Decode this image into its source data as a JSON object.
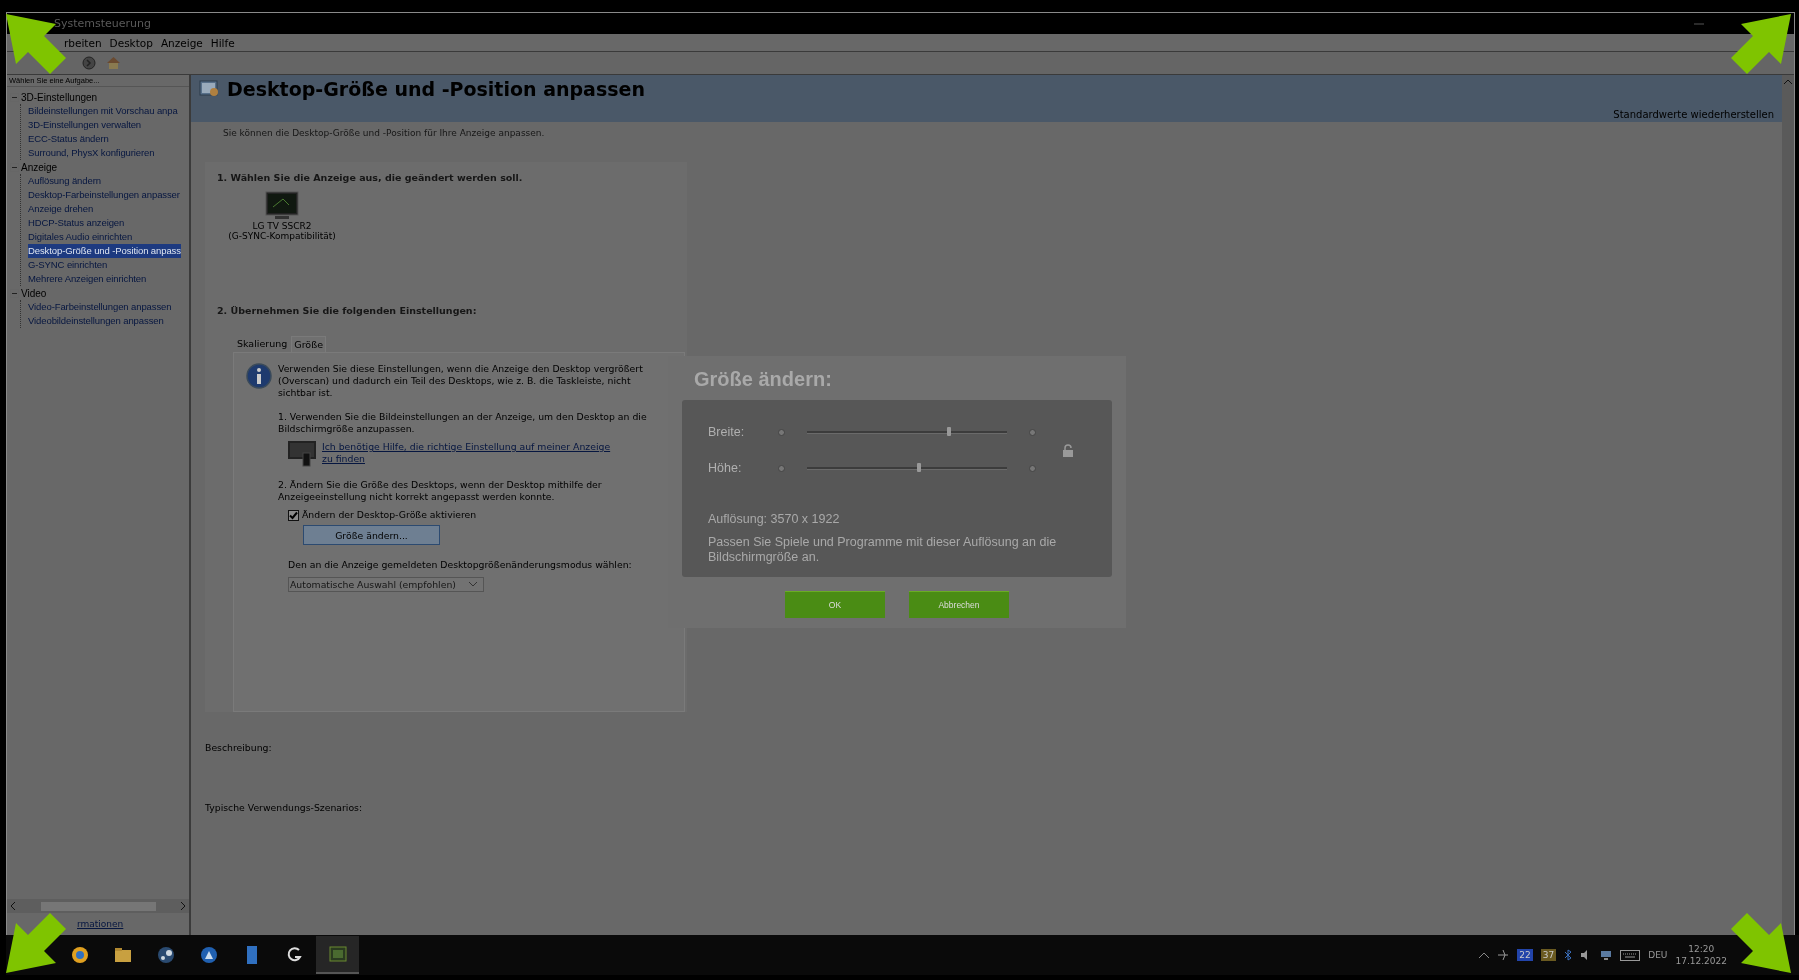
{
  "window": {
    "title": "Systemsteuerung"
  },
  "menu": [
    "rbeiten",
    "Desktop",
    "Anzeige",
    "Hilfe"
  ],
  "toolbar": {
    "hint": "Wählen Sie eine Aufgabe..."
  },
  "sidebar": {
    "tree": [
      {
        "label": "3D-Einstellungen",
        "expanded": true,
        "children": [
          {
            "label": "Bildeinstellungen mit Vorschau anpa",
            "selected": false
          },
          {
            "label": "3D-Einstellungen verwalten",
            "selected": false
          },
          {
            "label": "ECC-Status ändern",
            "selected": false
          },
          {
            "label": "Surround, PhysX konfigurieren",
            "selected": false
          }
        ]
      },
      {
        "label": "Anzeige",
        "expanded": true,
        "children": [
          {
            "label": "Auflösung ändern",
            "selected": false
          },
          {
            "label": "Desktop-Farbeinstellungen anpasser",
            "selected": false
          },
          {
            "label": "Anzeige drehen",
            "selected": false
          },
          {
            "label": "HDCP-Status anzeigen",
            "selected": false
          },
          {
            "label": "Digitales Audio einrichten",
            "selected": false
          },
          {
            "label": "Desktop-Größe und -Position anpass",
            "selected": true
          },
          {
            "label": "G-SYNC einrichten",
            "selected": false
          },
          {
            "label": "Mehrere Anzeigen einrichten",
            "selected": false
          }
        ]
      },
      {
        "label": "Video",
        "expanded": true,
        "children": [
          {
            "label": "Video-Farbeinstellungen anpassen",
            "selected": false
          },
          {
            "label": "Videobildeinstellungen anpassen",
            "selected": false
          }
        ]
      }
    ],
    "footer_link": "rmationen"
  },
  "page": {
    "title": "Desktop-Größe und -Position anpassen",
    "restore_link": "Standardwerte wiederherstellen",
    "intro": "Sie können die Desktop-Größe und -Position für Ihre Anzeige anpassen.",
    "step1": {
      "heading": "1. Wählen Sie die Anzeige aus, die geändert werden soll.",
      "display": {
        "name": "LG TV SSCR2",
        "subtitle": "(G-SYNC-Kompatibilität)"
      }
    },
    "step2": {
      "heading": "2. Übernehmen Sie die folgenden Einstellungen:",
      "tabs": [
        {
          "label": "Skalierung",
          "selected": false
        },
        {
          "label": "Größe",
          "selected": true
        }
      ],
      "info": "Verwenden Sie diese Einstellungen, wenn die Anzeige den Desktop vergrößert (Overscan) und dadurch ein Teil des Desktops, wie z. B. die Taskleiste, nicht sichtbar ist.",
      "item1": "1. Verwenden Sie die Bildeinstellungen an der Anzeige, um den Desktop an die Bildschirmgröße anzupassen.",
      "help_link": "Ich benötige Hilfe, die richtige Einstellung auf meiner Anzeige zu finden",
      "item2": "2. Ändern Sie die Größe des Desktops, wenn der Desktop mithilfe der Anzeigeeinstellung nicht korrekt angepasst werden konnte.",
      "checkbox": {
        "label": "Ändern der Desktop-Größe aktivieren",
        "checked": true
      },
      "resize_button": "Größe ändern...",
      "mode_label": "Den an die Anzeige gemeldeten Desktopgrößenänderungsmodus wählen:",
      "mode_select": "Automatische Auswahl (empfohlen)"
    },
    "description_label": "Beschreibung:",
    "scenarios_label": "Typische Verwendungs-Szenarios:"
  },
  "dialog": {
    "title": "Größe ändern:",
    "sliders": [
      {
        "label": "Breite:",
        "level": 0.71
      },
      {
        "label": "Höhe:",
        "level": 0.56
      }
    ],
    "resolution": "Auflösung: 3570 x 1922",
    "note": "Passen Sie Spiele und Programme mit dieser Auflösung an die Bildschirmgröße an.",
    "buttons": [
      "OK",
      "Abbrechen"
    ]
  },
  "taskbar": {
    "badges": [
      "22",
      "37"
    ],
    "language": "DEU",
    "time": "12:20",
    "date": "17.12.2022"
  }
}
